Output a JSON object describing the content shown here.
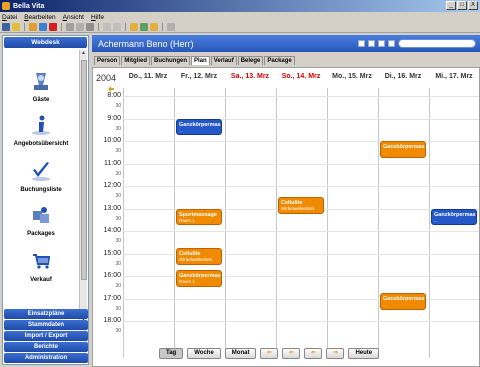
{
  "window": {
    "title": "Bella Vita",
    "min": "_",
    "max": "□",
    "close": "X"
  },
  "menu": [
    "Datei",
    "Bearbeiten",
    "Ansicht",
    "Hilfe"
  ],
  "sidebar": {
    "header": "Webdesk",
    "items": [
      {
        "label": "Gäste",
        "icon": "guests-icon"
      },
      {
        "label": "Angebotsübersicht",
        "icon": "info-icon"
      },
      {
        "label": "Buchungsliste",
        "icon": "checkmark-icon"
      },
      {
        "label": "Packages",
        "icon": "packages-icon"
      },
      {
        "label": "Verkauf",
        "icon": "cart-icon"
      }
    ],
    "bottom_buttons": [
      "Einsatzpläne",
      "Stammdaten",
      "Import / Export",
      "Berichte",
      "Administration"
    ]
  },
  "main": {
    "guest_name": "Achermann Beno (Herr)",
    "tabs": [
      "Person",
      "Mitglied",
      "Buchungen",
      "Plan",
      "Verlauf",
      "Belege",
      "Package"
    ],
    "active_tab": "Plan"
  },
  "calendar": {
    "year": "2004",
    "days": [
      {
        "label": "Do., 11. Mrz",
        "weekend": false
      },
      {
        "label": "Fr., 12. Mrz",
        "weekend": false
      },
      {
        "label": "Sa., 13. Mrz",
        "weekend": true
      },
      {
        "label": "So., 14. Mrz",
        "weekend": true
      },
      {
        "label": "Mo., 15. Mrz",
        "weekend": false
      },
      {
        "label": "Di., 16. Mrz",
        "weekend": false
      },
      {
        "label": "Mi., 17. Mrz",
        "weekend": false
      }
    ],
    "hours": [
      "8:00",
      "9:00",
      "10:00",
      "11:00",
      "12:00",
      "13:00",
      "14:00",
      "15:00",
      "16:00",
      "17:00",
      "18:00"
    ],
    "half_label": "30",
    "events": [
      {
        "day": 1,
        "start": 9.0,
        "end": 9.75,
        "title": "Ganzkörpermas",
        "sub": "...",
        "color": "blue"
      },
      {
        "day": 1,
        "start": 13.0,
        "end": 13.75,
        "title": "Sportmassage",
        "sub": "Raum 1",
        "color": "orange"
      },
      {
        "day": 1,
        "start": 14.75,
        "end": 15.5,
        "title": "Cellulite",
        "sub": "Wirbelwellenbeh.",
        "color": "orange"
      },
      {
        "day": 1,
        "start": 15.75,
        "end": 16.5,
        "title": "Ganzkörpermas",
        "sub": "Raum 1",
        "color": "orange"
      },
      {
        "day": 3,
        "start": 12.5,
        "end": 13.25,
        "title": "Cellulite",
        "sub": "Wirbelwellenbeh.",
        "color": "orange"
      },
      {
        "day": 5,
        "start": 10.0,
        "end": 10.75,
        "title": "Ganzkörpermas",
        "sub": "...",
        "color": "orange"
      },
      {
        "day": 5,
        "start": 16.75,
        "end": 17.5,
        "title": "Ganzkörpermas",
        "sub": "...",
        "color": "orange"
      },
      {
        "day": 6,
        "start": 13.0,
        "end": 13.75,
        "title": "Ganzkörpermas",
        "sub": "...",
        "color": "blue"
      }
    ]
  },
  "nav": {
    "views": [
      "Tag",
      "Woche",
      "Monat"
    ],
    "active_view": "Tag",
    "arrows": [
      "⇐",
      "⇐",
      "⇐",
      "⇒"
    ],
    "today": "Heute"
  },
  "colors": {
    "accent": "#2756b8",
    "event_orange": "#f08a00",
    "event_blue": "#2458c8",
    "weekend": "#d00000"
  }
}
